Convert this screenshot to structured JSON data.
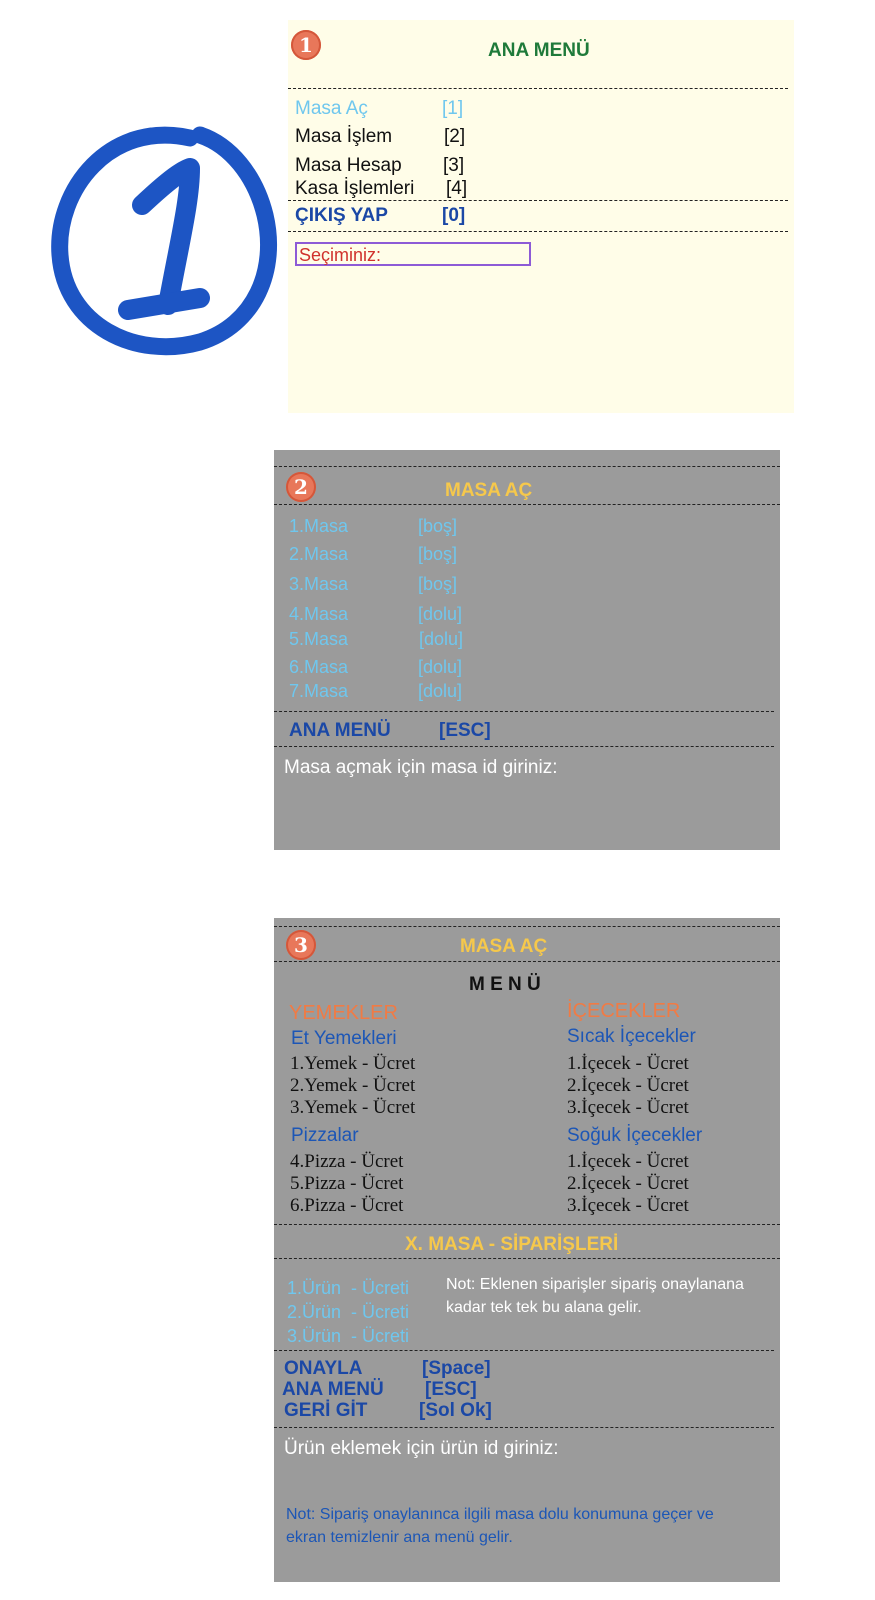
{
  "logo": {
    "text": "1"
  },
  "panel1": {
    "badge": "1",
    "title": "ANA MENÜ",
    "items": [
      {
        "label": "Masa Aç",
        "key": "[1]"
      },
      {
        "label": "Masa İşlem",
        "key": "[2]"
      },
      {
        "label": "Masa Hesap",
        "key": "[3]"
      },
      {
        "label": "Kasa İşlemleri",
        "key": "[4]"
      }
    ],
    "exit": {
      "label": "ÇIKIŞ YAP",
      "key": "[0]"
    },
    "prompt": "Seçiminiz:"
  },
  "panel2": {
    "badge": "2",
    "title": "MASA AÇ",
    "tables": [
      {
        "name": "1.Masa",
        "status": "[boş]"
      },
      {
        "name": "2.Masa",
        "status": "[boş]"
      },
      {
        "name": "3.Masa",
        "status": "[boş]"
      },
      {
        "name": "4.Masa",
        "status": "[dolu]"
      },
      {
        "name": "5.Masa",
        "status": "[dolu]"
      },
      {
        "name": "6.Masa",
        "status": "[dolu]"
      },
      {
        "name": "7.Masa",
        "status": "[dolu]"
      }
    ],
    "nav": {
      "label": "ANA MENÜ",
      "key": "[ESC]"
    },
    "prompt": "Masa açmak için masa id giriniz:"
  },
  "panel3": {
    "badge": "3",
    "title": "MASA AÇ",
    "menu_title": "M E N Ü",
    "food": {
      "heading": "YEMEKLER",
      "groups": [
        {
          "name": "Et Yemekleri",
          "items": [
            "1.Yemek - Ücret",
            "2.Yemek - Ücret",
            "3.Yemek - Ücret"
          ]
        },
        {
          "name": "Pizzalar",
          "items": [
            "4.Pizza - Ücret",
            "5.Pizza - Ücret",
            "6.Pizza - Ücret"
          ]
        }
      ]
    },
    "drinks": {
      "heading": "İÇECEKLER",
      "groups": [
        {
          "name": "Sıcak İçecekler",
          "items": [
            "1.İçecek - Ücret",
            "2.İçecek - Ücret",
            "3.İçecek - Ücret"
          ]
        },
        {
          "name": "Soğuk İçecekler",
          "items": [
            "1.İçecek - Ücret",
            "2.İçecek - Ücret",
            "3.İçecek - Ücret"
          ]
        }
      ]
    },
    "orders_title": "X. MASA - SİPARİŞLERİ",
    "orders": [
      "1.Ürün  - Ücreti",
      "2.Ürün  - Ücreti",
      "3.Ürün  - Ücreti"
    ],
    "orders_note_1": "Not: Eklenen siparişler sipariş onaylanana",
    "orders_note_2": "kadar tek tek bu alana gelir.",
    "actions": [
      {
        "label": "ONAYLA",
        "key": "[Space]"
      },
      {
        "label": "ANA MENÜ",
        "key": "[ESC]"
      },
      {
        "label": "GERİ GİT",
        "key": "[Sol Ok]"
      }
    ],
    "prompt": "Ürün eklemek için ürün id giriniz:",
    "footer_note_1": "Not: Sipariş onaylanınca ilgili masa dolu konumuna geçer ve",
    "footer_note_2": "ekran temizlenir ana menü gelir."
  }
}
